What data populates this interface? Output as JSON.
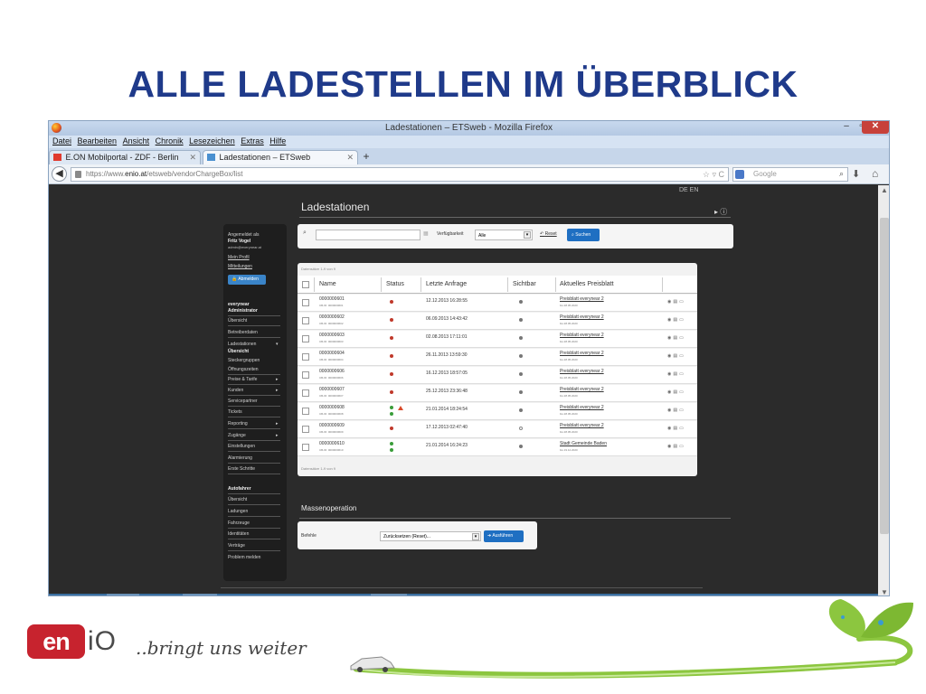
{
  "slide": {
    "title": "ALLE LADESTELLEN IM ÜBERBLICK",
    "logo_text": "iO",
    "tagline": "..bringt uns  weiter"
  },
  "browser": {
    "window_title": "Ladestationen – ETSweb - Mozilla Firefox",
    "window_controls": {
      "minimize": "–",
      "maximize": "▫",
      "close": "✕"
    },
    "menu": [
      "Datei",
      "Bearbeiten",
      "Ansicht",
      "Chronik",
      "Lesezeichen",
      "Extras",
      "Hilfe"
    ],
    "tabs": [
      {
        "label": "E.ON Mobilportal - ZDF - Berlin",
        "active": false
      },
      {
        "label": "Ladestationen – ETSweb",
        "active": true
      }
    ],
    "new_tab": "+",
    "url_scheme": "https://www.",
    "url_host": "enio.at",
    "url_path": "/etsweb/vendorChargeBox/list",
    "search_placeholder": "Google"
  },
  "page": {
    "lang": "DE EN",
    "heading": "Ladestationen",
    "help": "▸ ⓘ",
    "sidebar": {
      "logged_in_as": "Angemeldet als",
      "user_name": "Fritz Vogel",
      "user_email": "admin@everynear.at",
      "profile": "Mein Profil",
      "messages": "Mitteilungen",
      "logout": "Abmelden",
      "section1_title_1": "everynear",
      "section1_title_2": "Administrator",
      "items1": [
        "Übersicht",
        "Betreiberdaten",
        "Ladestationen",
        "Übersicht",
        "Steckergruppen",
        "Öffnungszeiten",
        "Preise & Tarife",
        "Kunden",
        "Servicepartner",
        "Tickets",
        "Reporting",
        "Zugänge",
        "Einstellungen",
        "Alarmierung",
        "Erste Schritte"
      ],
      "section2_title": "Autofahrer",
      "items2": [
        "Übersicht",
        "Ladungen",
        "Fahrzeuge",
        "Identitäten",
        "Verträge",
        "Problem melden"
      ]
    },
    "filter": {
      "availability_label": "Verfügbarkeit",
      "availability_value": "Alle",
      "reset_label": "Reset",
      "search_button": "Suchen"
    },
    "table": {
      "count_top": "Datensätze 1-9 von 9",
      "count_bottom": "Datensätze 1-9 von 9",
      "columns": [
        "Name",
        "Status",
        "Letzte Anfrage",
        "Sichtbar",
        "Aktuelles Preisblatt"
      ],
      "rows": [
        {
          "name": "0000000601",
          "cbid": "CB-ID: 0000000601",
          "last": "12.12.2013 16:28:55",
          "price": "Preisblatt everynear 2",
          "pdate": "bis 28.05.2020"
        },
        {
          "name": "0000000602",
          "cbid": "CB-ID: 0000000602",
          "last": "06.09.2013 14:43:42",
          "price": "Preisblatt everynear 2",
          "pdate": "bis 28.05.2020"
        },
        {
          "name": "0000000603",
          "cbid": "CB-ID: 0000000603",
          "last": "02.08.2013 17:11:01",
          "price": "Preisblatt everynear 2",
          "pdate": "bis 28.05.2020"
        },
        {
          "name": "0000000604",
          "cbid": "CB-ID: 0000000604",
          "last": "26.11.2013 13:59:30",
          "price": "Preisblatt everynear 2",
          "pdate": "bis 28.05.2020"
        },
        {
          "name": "0000000606",
          "cbid": "CB-ID: 0000000606",
          "last": "16.12.2013 18:57:05",
          "price": "Preisblatt everynear 2",
          "pdate": "bis 28.05.2020"
        },
        {
          "name": "0000000607",
          "cbid": "CB-ID: 0000000607",
          "last": "25.12.2013 23:36:48",
          "price": "Preisblatt everynear 2",
          "pdate": "bis 28.05.2020"
        },
        {
          "name": "0000000608",
          "cbid": "CB-ID: 0000000608",
          "last": "21.01.2014 18:24:54",
          "price": "Preisblatt everynear 2",
          "pdate": "bis 28.05.2020"
        },
        {
          "name": "0000000609",
          "cbid": "CB-ID: 0000000609",
          "last": "17.12.2013 02:47:40",
          "price": "Preisblatt everynear 2",
          "pdate": "bis 28.05.2020"
        },
        {
          "name": "0000000610",
          "cbid": "CB-ID: 0000000610",
          "last": "21.01.2014 16:24:23",
          "price": "Stadt Gemeinde Baden",
          "pdate": "bis 19.12.2020"
        }
      ]
    },
    "mass": {
      "heading": "Massenoperation",
      "command_label": "Befehle",
      "command_value": "Zurücksetzen (Reset)...",
      "execute_button": "Ausführen"
    }
  }
}
